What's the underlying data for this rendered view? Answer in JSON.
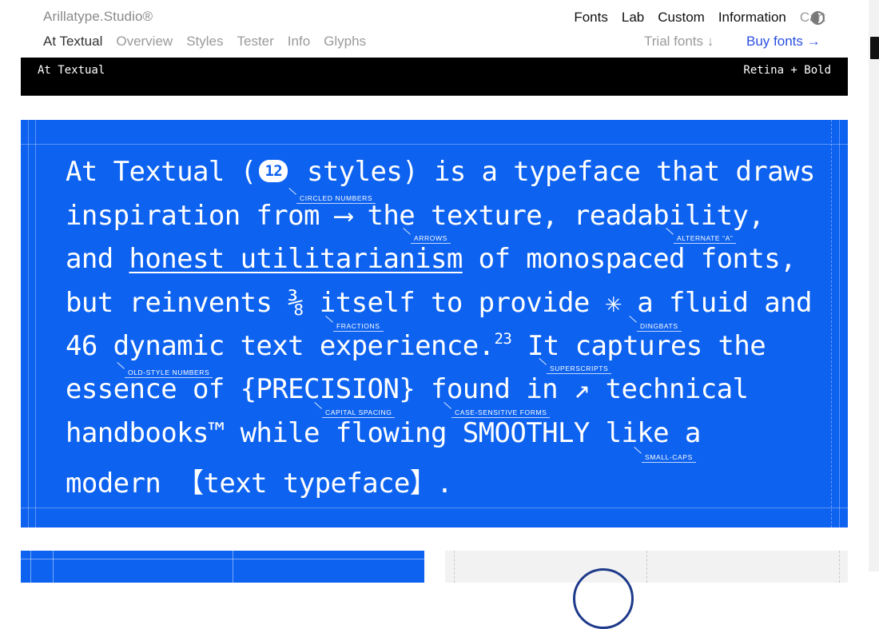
{
  "header": {
    "brand": "Arillatype.Studio®",
    "subnav": [
      "At Textual",
      "Overview",
      "Styles",
      "Tester",
      "Info",
      "Glyphs"
    ],
    "mainnav": [
      "Fonts",
      "Lab",
      "Custom",
      "Information",
      "Cart"
    ],
    "trial": "Trial fonts ↓",
    "buy": "Buy fonts →"
  },
  "bar": {
    "left": "At Textual",
    "right": "Retina + Bold"
  },
  "specimen": {
    "l1_a": "At Textual (",
    "l1_pill": "12",
    "l1_b": " styles) is a typeface that draws",
    "l2": "inspiration from ⟶ the texture, readability,",
    "l3_a": "and ",
    "l3_u": "honest utilitarianism",
    "l3_b": " of monospaced fonts,",
    "l4": "but reinvents ⅜ itself to provide ✳ a fluid and",
    "l5_a": "46 dynamic text experience.",
    "l5_sup": "23",
    "l5_b": " It captures the",
    "l6": "essence of {PRECISION} found in ↗ technical",
    "l7": "handbooks™ while flowing SMOOTHLY like a",
    "l8": "modern 【text typeface】.",
    "annotations": {
      "circled": "CIRCLED NUMBERS",
      "arrows": "ARROWS",
      "alternate": "ALTERNATE “A”",
      "fractions": "FRACTIONS",
      "dingbats": "DINGBATS",
      "oldstyle": "OLD-STYLE NUMBERS",
      "superscripts": "SUPERSCRIPTS",
      "capital": "CAPITAL SPACING",
      "case": "CASE-SENSITIVE FORMS",
      "smallcaps": "SMALL-CAPS"
    }
  }
}
